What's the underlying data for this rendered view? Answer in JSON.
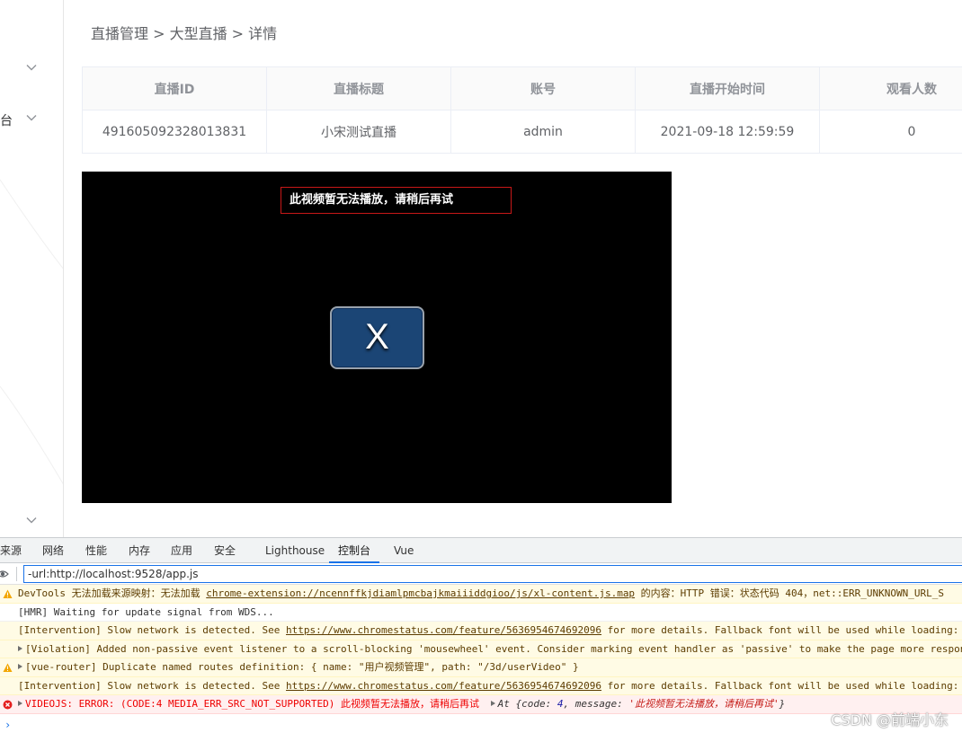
{
  "sidebar": {
    "partial_label": "台"
  },
  "breadcrumb": "直播管理 > 大型直播 > 详情",
  "table": {
    "headers": [
      "直播ID",
      "直播标题",
      "账号",
      "直播开始时间",
      "观看人数"
    ],
    "row": [
      "491605092328013831",
      "小宋测试直播",
      "admin",
      "2021-09-18 12:59:59",
      "0"
    ]
  },
  "video": {
    "error_text": "此视频暂无法播放，请稍后再试",
    "close_glyph": "X"
  },
  "devtools": {
    "tabs": [
      "来源",
      "网络",
      "性能",
      "内存",
      "应用",
      "安全",
      "Lighthouse",
      "控制台",
      "Vue"
    ],
    "active_tab": "控制台",
    "filter_value": "-url:http://localhost:9528/app.js",
    "messages": [
      {
        "level": "warning",
        "icon": "warning-icon",
        "text_before": "DevTools 无法加载来源映射：无法加载 ",
        "link": "chrome-extension://ncennffkjdiamlpmcbajkmaiiiddgioo/js/xl-content.js.map",
        "text_after": " 的内容：HTTP 错误：状态代码 404，net::ERR_UNKNOWN_URL_S"
      },
      {
        "level": "info",
        "text": "[HMR] Waiting for update signal from WDS..."
      },
      {
        "level": "warning-plain",
        "text_before": "[Intervention] Slow network is detected. See ",
        "link": "https://www.chromestatus.com/feature/5636954674692096",
        "text_after": " for more details. Fallback font will be used while loading: h"
      },
      {
        "level": "warning-plain",
        "expandable": true,
        "text": "[Violation] Added non-passive event listener to a scroll-blocking 'mousewheel' event. Consider marking event handler as 'passive' to make the page more respons"
      },
      {
        "level": "warning",
        "icon": "warning-icon",
        "expandable": true,
        "text": "[vue-router] Duplicate named routes definition: { name: \"用户视频管理\", path: \"/3d/userVideo\" }"
      },
      {
        "level": "warning-plain",
        "text_before": "[Intervention] Slow network is detected. See ",
        "link": "https://www.chromestatus.com/feature/5636954674692096",
        "text_after": " for more details. Fallback font will be used while loading: h"
      },
      {
        "level": "error",
        "icon": "error-icon",
        "expandable": true,
        "text": "VIDEOJS: ERROR: (CODE:4 MEDIA_ERR_SRC_NOT_SUPPORTED) 此视频暂无法播放，请稍后再试",
        "detail_prefix": "At {code: ",
        "detail_code": "4",
        "detail_mid": ", message: ",
        "detail_msg": "'此视频暂无法播放，请稍后再试'",
        "detail_suffix": "}"
      }
    ],
    "prompt": "›"
  },
  "watermark": "CSDN @前端小东",
  "colors": {
    "accent": "#1a73e8",
    "error": "#e00000",
    "video_button": "#1b4575",
    "warning_bg": "#fffbe5"
  }
}
